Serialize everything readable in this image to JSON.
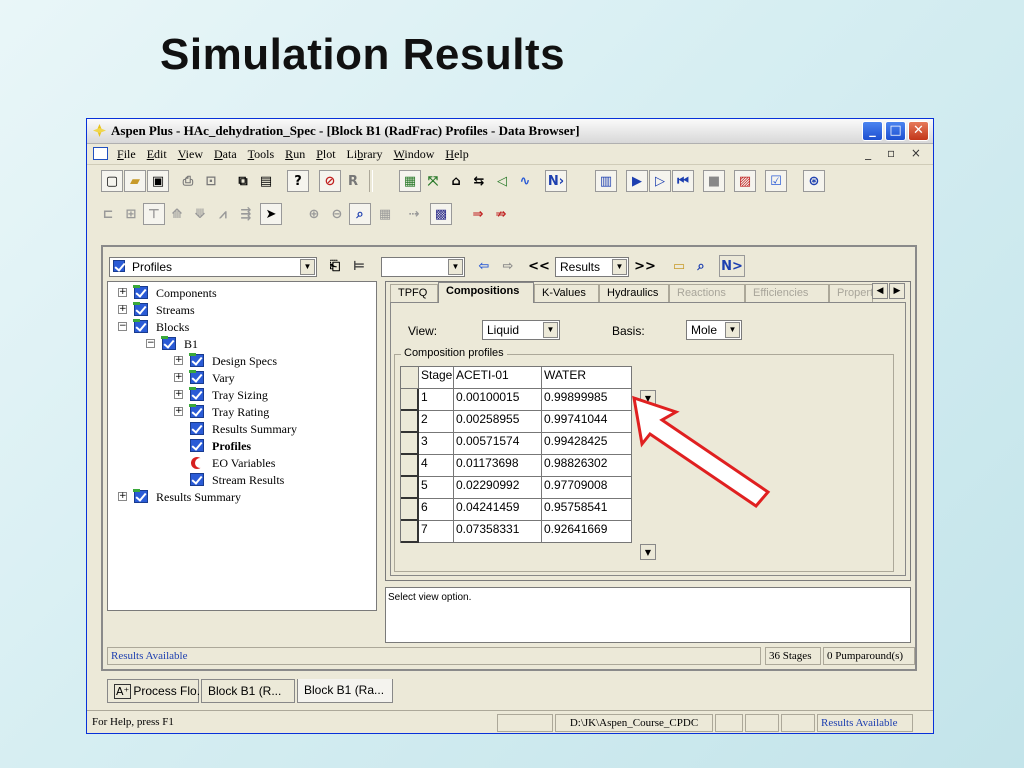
{
  "slide": {
    "title": "Simulation Results"
  },
  "window": {
    "title": "Aspen Plus - HAc_dehydration_Spec - [Block B1 (RadFrac) Profiles - Data Browser]",
    "controls": {
      "minimize": "_",
      "maximize": "□",
      "close": "✕"
    }
  },
  "menu": {
    "items": [
      {
        "pre": "",
        "u": "F",
        "post": "ile"
      },
      {
        "pre": "",
        "u": "E",
        "post": "dit"
      },
      {
        "pre": "",
        "u": "V",
        "post": "iew"
      },
      {
        "pre": "",
        "u": "D",
        "post": "ata"
      },
      {
        "pre": "",
        "u": "T",
        "post": "ools"
      },
      {
        "pre": "",
        "u": "R",
        "post": "un"
      },
      {
        "pre": "",
        "u": "P",
        "post": "lot"
      },
      {
        "pre": "Li",
        "u": "b",
        "post": "rary"
      },
      {
        "pre": "",
        "u": "W",
        "post": "indow"
      },
      {
        "pre": "",
        "u": "H",
        "post": "elp"
      }
    ],
    "mdi_controls": "_ ▫ ×"
  },
  "databrowser": {
    "folder_select": "Profiles",
    "nav_select": "",
    "results_select": "Results",
    "prev_label": "<<",
    "next_label": ">>",
    "next_run": "N>"
  },
  "tree": [
    {
      "label": "Components",
      "toggle": "+",
      "icon": "check-green",
      "level": 0
    },
    {
      "label": "Streams",
      "toggle": "+",
      "icon": "check-green",
      "level": 0
    },
    {
      "label": "Blocks",
      "toggle": "−",
      "icon": "check-green",
      "level": 0
    },
    {
      "label": "B1",
      "toggle": "−",
      "icon": "check-green",
      "level": 1
    },
    {
      "label": "Design Specs",
      "toggle": "+",
      "icon": "check-green",
      "level": 2
    },
    {
      "label": "Vary",
      "toggle": "+",
      "icon": "check-green",
      "level": 2
    },
    {
      "label": "Tray Sizing",
      "toggle": "+",
      "icon": "check-green",
      "level": 2
    },
    {
      "label": "Tray Rating",
      "toggle": "+",
      "icon": "check-green",
      "level": 2
    },
    {
      "label": "Results Summary",
      "toggle": "",
      "icon": "check",
      "level": 2
    },
    {
      "label": "Profiles",
      "toggle": "",
      "icon": "check",
      "level": 2,
      "bold": true
    },
    {
      "label": "EO Variables",
      "toggle": "",
      "icon": "half-moon",
      "level": 2
    },
    {
      "label": "Stream Results",
      "toggle": "",
      "icon": "check",
      "level": 2
    },
    {
      "label": "Results Summary",
      "toggle": "+",
      "icon": "check-green",
      "level": 0
    }
  ],
  "tabs": [
    {
      "label": "TPFQ",
      "state": "normal"
    },
    {
      "label": "Compositions",
      "state": "active"
    },
    {
      "label": "K-Values",
      "state": "normal"
    },
    {
      "label": "Hydraulics",
      "state": "normal"
    },
    {
      "label": "Reactions",
      "state": "disabled"
    },
    {
      "label": "Efficiencies",
      "state": "disabled"
    },
    {
      "label": "Properti",
      "state": "disabled"
    }
  ],
  "view": {
    "label": "View:",
    "value": "Liquid"
  },
  "basis": {
    "label": "Basis:",
    "value": "Mole"
  },
  "group_title": "Composition profiles",
  "grid": {
    "headers": [
      "Stage",
      "ACETI-01",
      "WATER"
    ],
    "rows": [
      [
        "1",
        "0.00100015",
        "0.99899985"
      ],
      [
        "2",
        "0.00258955",
        "0.99741044"
      ],
      [
        "3",
        "0.00571574",
        "0.99428425"
      ],
      [
        "4",
        "0.01173698",
        "0.98826302"
      ],
      [
        "5",
        "0.02290992",
        "0.97709008"
      ],
      [
        "6",
        "0.04241459",
        "0.95758541"
      ],
      [
        "7",
        "0.07358331",
        "0.92641669"
      ]
    ]
  },
  "message": "Select view option.",
  "db_status": {
    "left": "Results Available",
    "stages": "36 Stages",
    "pumparounds": "0 Pumparound(s)"
  },
  "mdi_tabs": [
    "Process Flo...",
    "Block B1 (R...",
    "Block B1 (Ra..."
  ],
  "statusbar": {
    "help": "For Help, press F1",
    "path": "D:\\JK\\Aspen_Course_CPDC",
    "status": "Results Available"
  },
  "colors": {
    "arrow": "#e02020",
    "check": "#2a5bd6",
    "titlebar_accent": "#0831d9"
  }
}
